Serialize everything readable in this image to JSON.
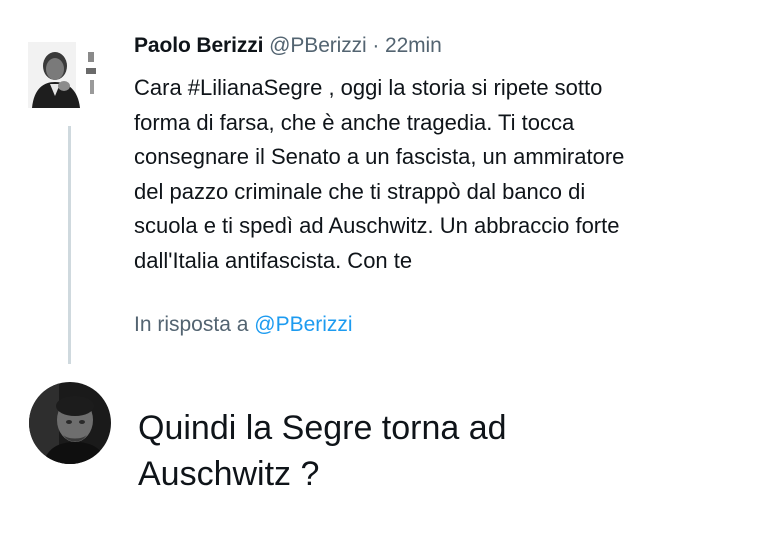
{
  "original_tweet": {
    "author_name": "Paolo Berizzi",
    "handle": "@PBerizzi",
    "separator": "·",
    "time": "22min",
    "text": "Cara #LilianaSegre , oggi la storia si ripete sotto\nforma di farsa, che è anche tragedia. Ti tocca\nconsegnare il Senato a un fascista, un ammiratore\ndel pazzo criminale che ti strappò dal banco di\nscuola e ti spedì ad Auschwitz. Un abbraccio forte\ndall'Italia antifascista. Con te"
  },
  "reply_context": {
    "prefix": "In risposta a",
    "handle": "@PBerizzi"
  },
  "reply": {
    "text": "Quindi la Segre torna ad\nAuschwitz ?"
  },
  "colors": {
    "text_primary": "#0f1419",
    "text_secondary": "#536471",
    "link": "#1d9bf0",
    "thread_line": "#cfd9de"
  }
}
